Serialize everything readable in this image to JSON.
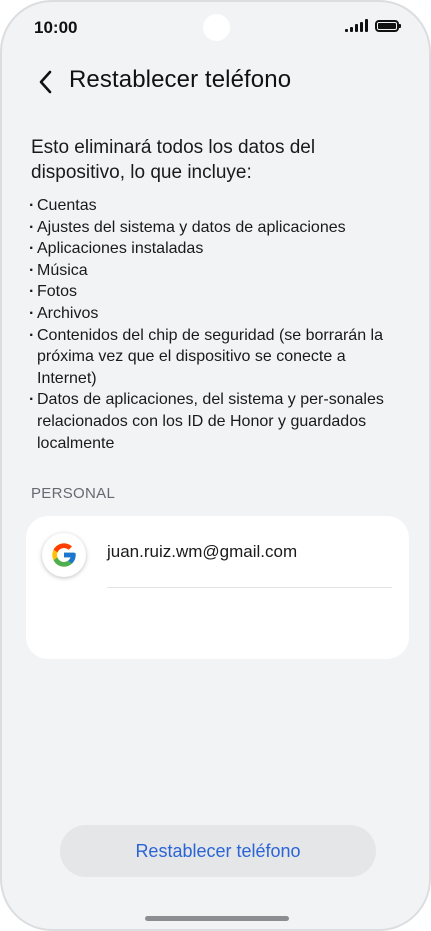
{
  "status_bar": {
    "time": "10:00"
  },
  "header": {
    "title": "Restablecer teléfono"
  },
  "content": {
    "intro": "Esto eliminará todos los datos del dispositivo, lo que incluye:",
    "bullets": [
      "Cuentas",
      "Ajustes del sistema y datos de aplicaciones",
      "Aplicaciones instaladas",
      "Música",
      "Fotos",
      "Archivos",
      "Contenidos del chip de seguridad (se borrarán la próxima vez que el dispositivo se conecte a Internet)",
      "Datos de aplicaciones, del sistema y per-sonales relacionados con los ID de Honor y guardados localmente"
    ]
  },
  "accounts": {
    "section_label": "PERSONAL",
    "items": [
      {
        "email": "juan.ruiz.wm@gmail.com",
        "icon": "google-icon"
      }
    ]
  },
  "footer": {
    "reset_label": "Restablecer teléfono"
  },
  "colors": {
    "background": "#f1f3f5",
    "card": "#ffffff",
    "accent": "#2a64d6",
    "button_bg": "#e4e6e8"
  }
}
